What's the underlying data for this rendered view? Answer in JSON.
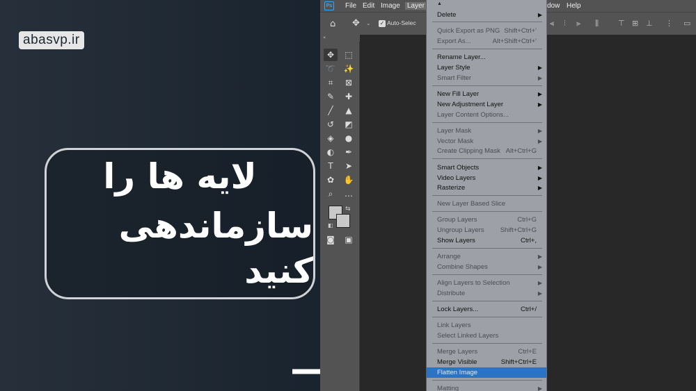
{
  "overlay": {
    "brand": "abasvp.ir",
    "callout_line1": "لایه ها را",
    "callout_line2": "سازماندهی کنید"
  },
  "menubar": {
    "logo": "Ps",
    "items": [
      "File",
      "Edit",
      "Image",
      "Layer",
      "dow",
      "Help"
    ]
  },
  "options_bar": {
    "home_icon": "home-icon",
    "auto_select": "Auto-Selecti"
  },
  "toolbar": {
    "collapse": "«"
  },
  "layer_menu": {
    "top_arrow": "▲",
    "items": [
      {
        "label": "Delete",
        "shortcut": "",
        "submenu": true,
        "disabled": false
      },
      {
        "label": "Quick Export as PNG",
        "shortcut": "Shift+Ctrl+'",
        "submenu": false,
        "disabled": true
      },
      {
        "label": "Export As...",
        "shortcut": "Alt+Shift+Ctrl+'",
        "submenu": false,
        "disabled": true
      },
      {
        "label": "Rename Layer...",
        "shortcut": "",
        "submenu": false,
        "disabled": false
      },
      {
        "label": "Layer Style",
        "shortcut": "",
        "submenu": true,
        "disabled": false
      },
      {
        "label": "Smart Filter",
        "shortcut": "",
        "submenu": true,
        "disabled": true
      },
      {
        "label": "New Fill Layer",
        "shortcut": "",
        "submenu": true,
        "disabled": false
      },
      {
        "label": "New Adjustment Layer",
        "shortcut": "",
        "submenu": true,
        "disabled": false
      },
      {
        "label": "Layer Content Options...",
        "shortcut": "",
        "submenu": false,
        "disabled": true
      },
      {
        "label": "Layer Mask",
        "shortcut": "",
        "submenu": true,
        "disabled": true
      },
      {
        "label": "Vector Mask",
        "shortcut": "",
        "submenu": true,
        "disabled": true
      },
      {
        "label": "Create Clipping Mask",
        "shortcut": "Alt+Ctrl+G",
        "submenu": false,
        "disabled": true
      },
      {
        "label": "Smart Objects",
        "shortcut": "",
        "submenu": true,
        "disabled": false
      },
      {
        "label": "Video Layers",
        "shortcut": "",
        "submenu": true,
        "disabled": false
      },
      {
        "label": "Rasterize",
        "shortcut": "",
        "submenu": true,
        "disabled": false
      },
      {
        "label": "New Layer Based Slice",
        "shortcut": "",
        "submenu": false,
        "disabled": true
      },
      {
        "label": "Group Layers",
        "shortcut": "Ctrl+G",
        "submenu": false,
        "disabled": true
      },
      {
        "label": "Ungroup Layers",
        "shortcut": "Shift+Ctrl+G",
        "submenu": false,
        "disabled": true
      },
      {
        "label": "Show Layers",
        "shortcut": "Ctrl+,",
        "submenu": false,
        "disabled": false
      },
      {
        "label": "Arrange",
        "shortcut": "",
        "submenu": true,
        "disabled": true
      },
      {
        "label": "Combine Shapes",
        "shortcut": "",
        "submenu": true,
        "disabled": true
      },
      {
        "label": "Align Layers to Selection",
        "shortcut": "",
        "submenu": true,
        "disabled": true
      },
      {
        "label": "Distribute",
        "shortcut": "",
        "submenu": true,
        "disabled": true
      },
      {
        "label": "Lock Layers...",
        "shortcut": "Ctrl+/",
        "submenu": false,
        "disabled": false
      },
      {
        "label": "Link Layers",
        "shortcut": "",
        "submenu": false,
        "disabled": true
      },
      {
        "label": "Select Linked Layers",
        "shortcut": "",
        "submenu": false,
        "disabled": true
      },
      {
        "label": "Merge Layers",
        "shortcut": "Ctrl+E",
        "submenu": false,
        "disabled": true
      },
      {
        "label": "Merge Visible",
        "shortcut": "Shift+Ctrl+E",
        "submenu": false,
        "disabled": false
      },
      {
        "label": "Flatten Image",
        "shortcut": "",
        "submenu": false,
        "disabled": false,
        "highlighted": true
      },
      {
        "label": "Matting",
        "shortcut": "",
        "submenu": true,
        "disabled": true
      }
    ]
  },
  "colors": {
    "highlight": "#2a73c5",
    "menu_bg": "#9da0a6",
    "ps_blue": "#31a8ff"
  }
}
